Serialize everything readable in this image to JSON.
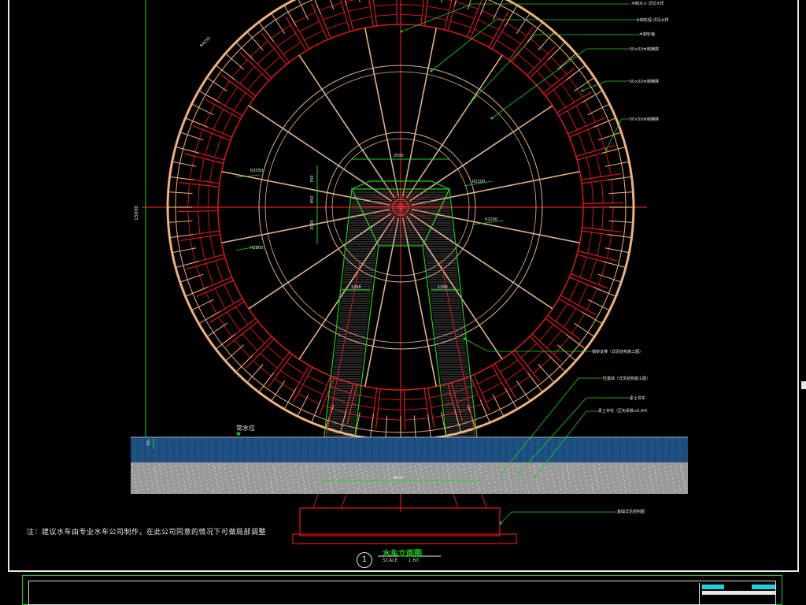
{
  "drawing": {
    "note": "注：建议水车由专业水车公司制作，在此公司同意的情况下可做局部调整",
    "caption_number": "1",
    "caption_title": "水车立面图",
    "caption_scale_left": "SCALE",
    "caption_scale_right": "1:60",
    "water_label": "常水位",
    "callouts": [
      "木制水斗 详见大样",
      "木制轮辐 详见大样",
      "木制轮轴",
      "50×50木制横撑",
      "50×50木制横撑",
      "50×50木制横撑",
      "钢架支撑（详见结构施工图）",
      "砼基础（详见结构施工图）",
      "素土夯实",
      "素土夯实（压实系数≥0.94）",
      "基础详见结构图"
    ],
    "dimensions": {
      "top_width": "2000",
      "left_a": "700",
      "left_b": "850",
      "left_c": "2000",
      "inner_left": "1300",
      "inner_right": "1300",
      "bottom_width": "8000",
      "overall_height": "15000",
      "r1": "R4250",
      "r2": "R3350",
      "r3": "R2800",
      "r4": "R2200",
      "water_depth": "500"
    }
  },
  "colors": {
    "rim": "#f0b07a",
    "bucket": "#e01818",
    "spoke": "#e0b48a",
    "dim": "#1ed11e",
    "axis": "#e01818",
    "water": "#1a4a7a",
    "ground": "#9a9a9a"
  }
}
